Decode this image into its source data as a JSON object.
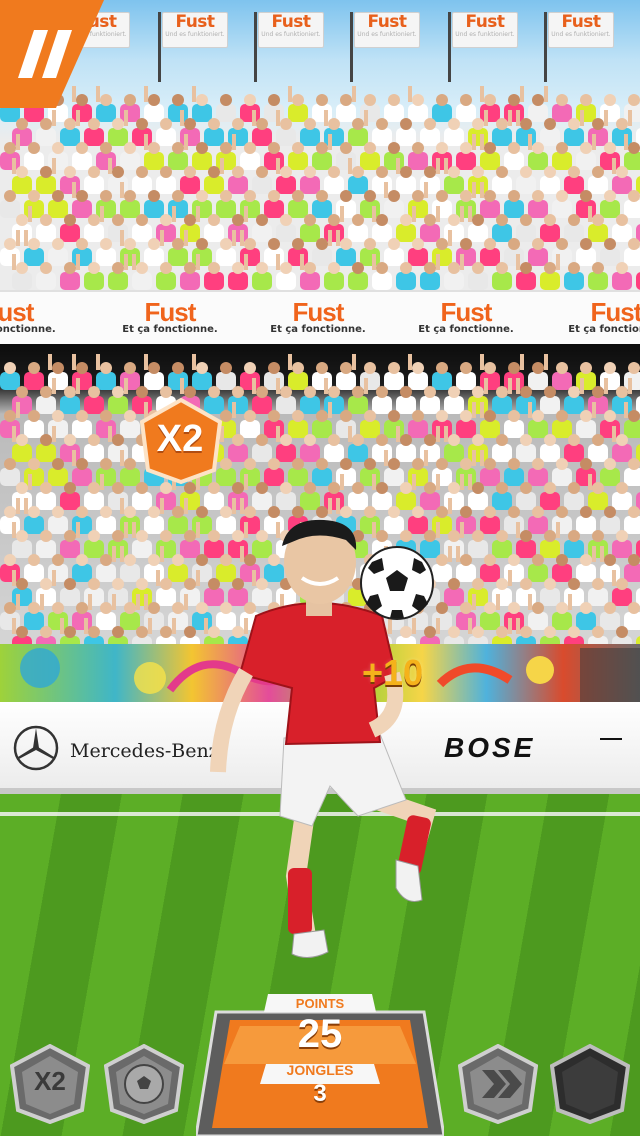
{
  "stadium": {
    "flag_brand": "Fust",
    "flag_slogan": "Und es funktioniert.",
    "board_brand": "Fust",
    "board_slogan": "Et ça fonctionne."
  },
  "sponsors": {
    "left_name": "Mercedes-Benz",
    "right_name": "BOSE"
  },
  "hud": {
    "pause_icon": "pause-icon",
    "multiplier_badge": "X2",
    "points_popup": "+10",
    "points_label": "POINTS",
    "points_value": "25",
    "jongles_label": "JONGLES",
    "jongles_value": "3",
    "powerups": [
      {
        "name": "x2-multiplier",
        "label": "X2",
        "active": false
      },
      {
        "name": "ball-powerup",
        "icon": "soccer-ball-icon",
        "active": false
      },
      {
        "name": "fast-forward-powerup",
        "icon": "double-chevron-icon",
        "active": false
      },
      {
        "name": "empty-slot",
        "icon": "shield-icon",
        "active": false
      }
    ]
  },
  "colors": {
    "accent_orange": "#f07a1e",
    "hud_gray": "#7d7d7d",
    "jersey_red": "#d8202a"
  }
}
